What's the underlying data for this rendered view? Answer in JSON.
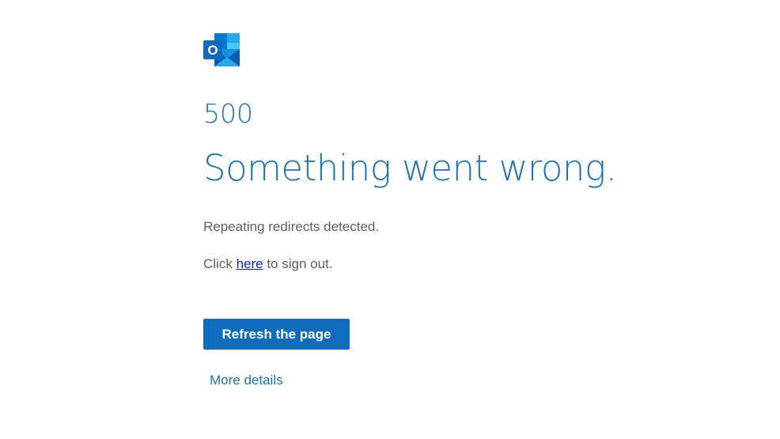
{
  "error": {
    "code": "500",
    "headline": "Something went wrong.",
    "message": "Repeating redirects detected.",
    "signout_prefix": "Click ",
    "signout_link": "here",
    "signout_suffix": " to sign out."
  },
  "actions": {
    "refresh_label": "Refresh the page",
    "more_details_label": "More details"
  },
  "logo": {
    "icon": "outlook-icon",
    "letter": "O"
  },
  "colors": {
    "accent": "#1a73b8",
    "button": "#0f6cbd",
    "link": "#0b27c7",
    "text": "#5f5f5f"
  }
}
